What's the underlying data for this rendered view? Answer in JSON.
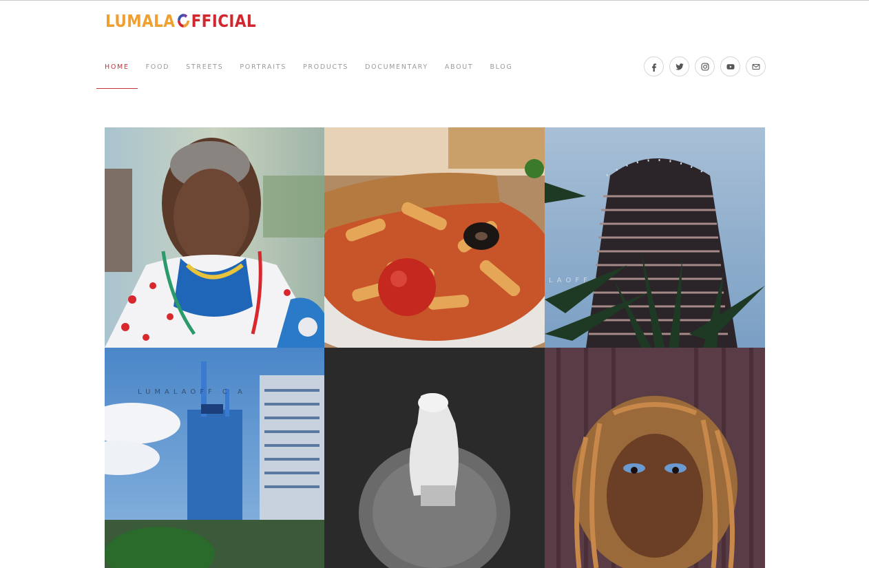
{
  "header": {
    "logo": {
      "part1": "LUMALA ",
      "part2": "FFICIAL"
    }
  },
  "nav": {
    "items": [
      {
        "label": "HOME",
        "active": true
      },
      {
        "label": "FOOD",
        "active": false
      },
      {
        "label": "STREETS",
        "active": false
      },
      {
        "label": "PORTRAITS",
        "active": false
      },
      {
        "label": "PRODUCTS",
        "active": false
      },
      {
        "label": "DOCUMENTARY",
        "active": false
      },
      {
        "label": "ABOUT",
        "active": false
      },
      {
        "label": "BLOG",
        "active": false
      }
    ]
  },
  "social": [
    "facebook-icon",
    "twitter-icon",
    "instagram-icon",
    "youtube-icon",
    "mail-icon"
  ],
  "gallery": {
    "tiles": [
      {
        "name": "maasai-elder-portrait"
      },
      {
        "name": "pasta-dish"
      },
      {
        "name": "kicc-tower",
        "watermark": "LAOFF"
      },
      {
        "name": "nairobi-skyline",
        "watermark": "LUMALAOFF C A"
      },
      {
        "name": "prayer-mat-monochrome"
      },
      {
        "name": "woman-with-locs-portrait"
      }
    ]
  },
  "colors": {
    "accent": "#c4323a",
    "logo_orange": "#f0a030",
    "logo_red": "#d0282e",
    "nav_text": "#9a9a9a"
  }
}
